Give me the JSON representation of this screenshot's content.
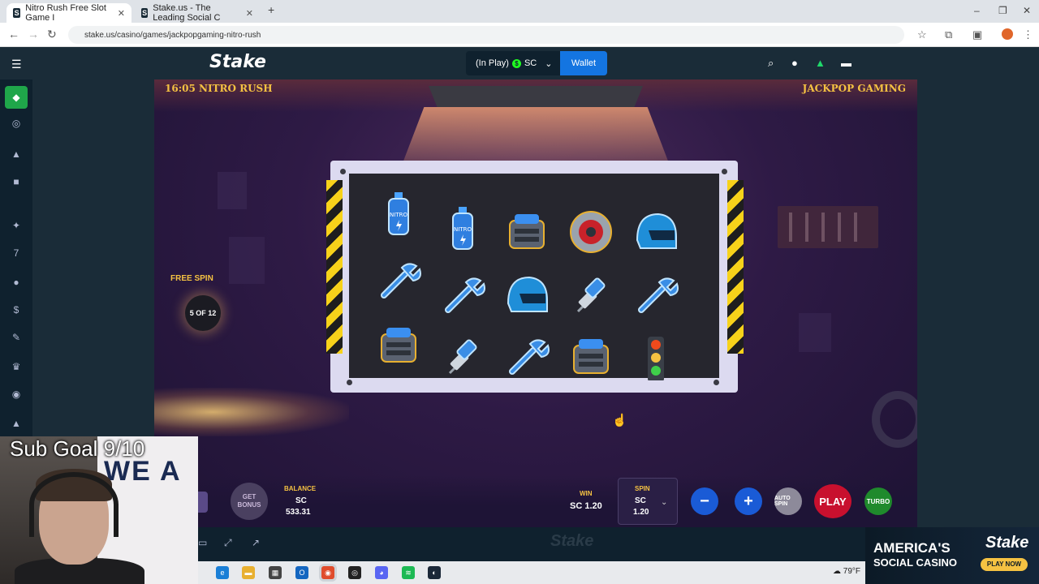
{
  "browser": {
    "tabs": [
      {
        "title": "Nitro Rush Free Slot Game I",
        "active": true
      },
      {
        "title": "Stake.us - The Leading Social C",
        "active": false
      }
    ],
    "url": "stake.us/casino/games/jackpopgaming-nitro-rush",
    "new_tab": "+"
  },
  "site": {
    "logo": "Stake",
    "balance_label": "(In Play)",
    "currency": "SC",
    "wallet_label": "Wallet"
  },
  "game": {
    "title": "16:05 NITRO RUSH",
    "provider": "JACKPOP GAMING",
    "free_spin_label": "FREE SPIN",
    "free_spin_count": "5 OF 12",
    "reels": [
      [
        "nitro-bottle",
        "nitro-bottle",
        "engine",
        "brake-disc",
        "helmet"
      ],
      [
        "wrench",
        "wrench",
        "helmet",
        "spark-plug",
        "wrench"
      ],
      [
        "engine",
        "spark-plug",
        "wrench",
        "engine",
        "traffic-light"
      ]
    ],
    "bonus_label": "GET BONUS",
    "balance_label": "BALANCE",
    "balance_currency": "SC",
    "balance_value": "533.31",
    "win_label": "WIN",
    "win_value": "SC 1.20",
    "spin_label": "SPIN",
    "spin_currency": "SC",
    "spin_value": "1.20",
    "autospin_label": "AUTO SPIN",
    "play_label": "PLAY",
    "turbo_label": "TURBO"
  },
  "stream": {
    "sub_goal": "Sub Goal 9/10",
    "wall_text": "WE A"
  },
  "ad": {
    "line1": "AMERICA'S",
    "line2": "SOCIAL CASINO",
    "logo": "Stake",
    "cta": "PLAY NOW"
  },
  "taskbar": {
    "weather": "79°F"
  },
  "colors": {
    "accent_gold": "#f5c242",
    "wallet_blue": "#1475e1",
    "play_red": "#c8102e",
    "turbo_green": "#1f8a2c"
  }
}
